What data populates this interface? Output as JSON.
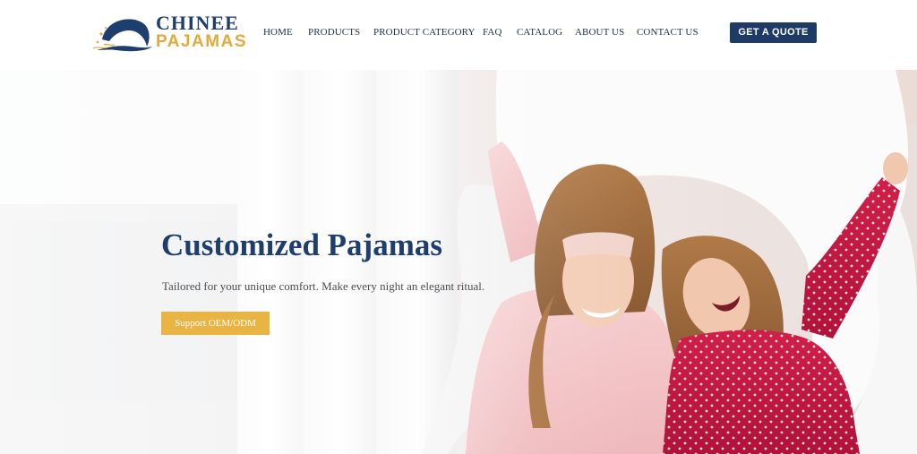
{
  "brand": {
    "name_line1": "CHINEE",
    "name_line2": "PAJAMAS"
  },
  "nav": {
    "items": [
      {
        "label": "HOME"
      },
      {
        "label": "PRODUCTS"
      },
      {
        "label": "PRODUCT CATEGORY"
      },
      {
        "label": "FAQ"
      },
      {
        "label": "CATALOG"
      },
      {
        "label": "ABOUT US"
      },
      {
        "label": "CONTACT US"
      }
    ],
    "cta_label": "GET A QUOTE"
  },
  "hero": {
    "title": "Customized Pajamas",
    "subtitle": "Tailored for your unique comfort. Make every night an elegant ritual.",
    "button_label": "Support OEM/ODM"
  },
  "colors": {
    "navy": "#1e3f6e",
    "gold": "#e2aa3a",
    "button_navy": "#1d3b66",
    "button_gold": "#e8b443"
  },
  "icons": {
    "logo": "moon-wave-logo-icon"
  }
}
